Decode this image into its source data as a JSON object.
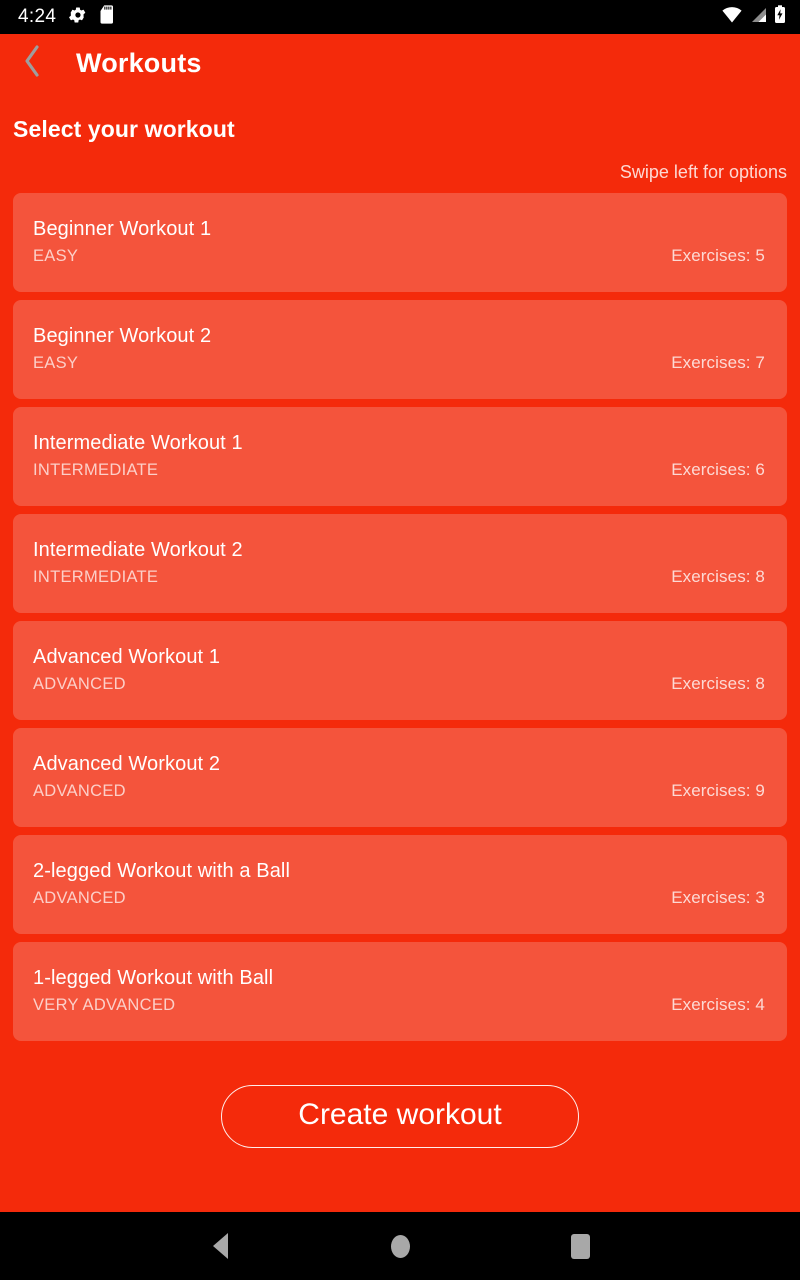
{
  "statusbar": {
    "time": "4:24",
    "icons_left": [
      "gear-icon",
      "sd-card-icon"
    ],
    "icons_right": [
      "wifi-icon",
      "cellular-signal-icon",
      "battery-charging-icon"
    ]
  },
  "appbar": {
    "back_icon": "chevron-left-icon",
    "title": "Workouts"
  },
  "main": {
    "section_title": "Select your workout",
    "swipe_hint": "Swipe left for options",
    "workouts": [
      {
        "title": "Beginner Workout 1",
        "level": "EASY",
        "exercises": "Exercises: 5"
      },
      {
        "title": "Beginner Workout 2",
        "level": "EASY",
        "exercises": "Exercises: 7"
      },
      {
        "title": "Intermediate Workout 1",
        "level": "INTERMEDIATE",
        "exercises": "Exercises: 6"
      },
      {
        "title": "Intermediate Workout 2",
        "level": "INTERMEDIATE",
        "exercises": "Exercises: 8"
      },
      {
        "title": "Advanced Workout 1",
        "level": "ADVANCED",
        "exercises": "Exercises: 8"
      },
      {
        "title": "Advanced Workout 2",
        "level": "ADVANCED",
        "exercises": "Exercises: 9"
      },
      {
        "title": "2-legged Workout with a Ball",
        "level": "ADVANCED",
        "exercises": "Exercises: 3"
      },
      {
        "title": "1-legged Workout with Ball",
        "level": "VERY ADVANCED",
        "exercises": "Exercises: 4"
      }
    ],
    "create_button": "Create workout"
  },
  "navbar": {
    "back": "back-nav-button",
    "home": "home-nav-button",
    "recents": "recents-nav-button"
  },
  "colors": {
    "background": "#F42A0B",
    "card": "#F4543C",
    "statusbar": "#000000",
    "text": "#FFFFFF",
    "nav_icon": "#A8A8A8"
  }
}
